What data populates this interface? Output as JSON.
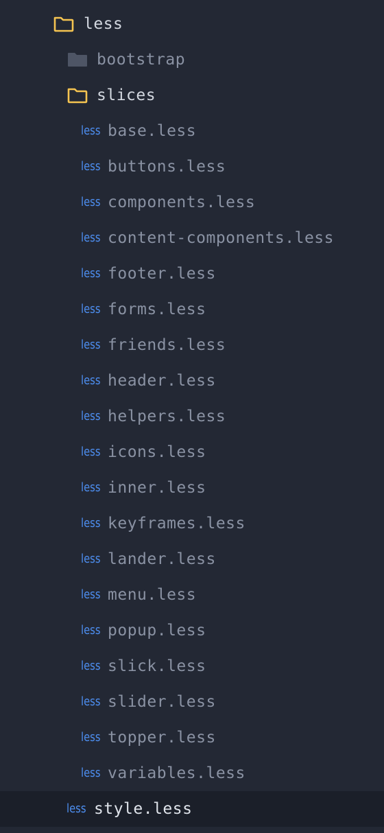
{
  "root": {
    "label": "less",
    "icon": "folder-open-icon",
    "icon_color": "#f5c451"
  },
  "folders": [
    {
      "label": "bootstrap",
      "state": "collapsed",
      "icon": "folder-closed-icon",
      "icon_color": "#4e5565"
    },
    {
      "label": "slices",
      "state": "expanded",
      "icon": "folder-open-icon",
      "icon_color": "#f5c451"
    }
  ],
  "file_icon_text": "less",
  "file_icon_color": "#4d8ef0",
  "slices_files": [
    "base.less",
    "buttons.less",
    "components.less",
    "content-components.less",
    "footer.less",
    "forms.less",
    "friends.less",
    "header.less",
    "helpers.less",
    "icons.less",
    "inner.less",
    "keyframes.less",
    "lander.less",
    "menu.less",
    "popup.less",
    "slick.less",
    "slider.less",
    "topper.less",
    "variables.less"
  ],
  "root_file": {
    "label": "style.less",
    "selected": true
  }
}
